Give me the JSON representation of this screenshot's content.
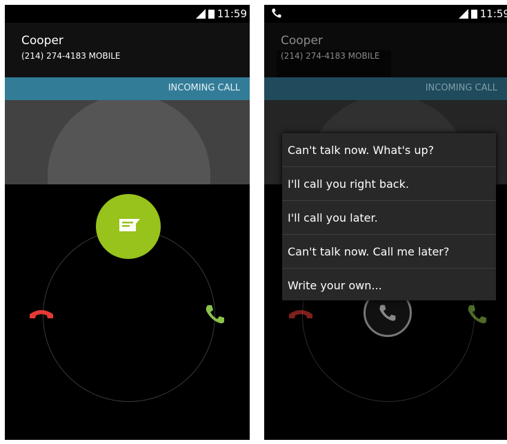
{
  "screen1": {
    "status_time": "11:59",
    "caller_name": "Cooper",
    "caller_number": "(214) 274-4183  MOBILE",
    "incoming_label": "INCOMING CALL"
  },
  "screen2": {
    "status_time": "11:59",
    "caller_name": "Cooper",
    "caller_number": "(214) 274-4183  MOBILE",
    "incoming_label": "INCOMING CALL",
    "quick_responses": [
      "Can't talk now. What's up?",
      "I'll call you right back.",
      "I'll call you later.",
      "Can't talk now. Call me later?",
      "Write your own..."
    ]
  },
  "colors": {
    "accent_blue": "#327c98",
    "message_green": "#98c21c",
    "decline_red": "#e53935",
    "answer_green": "#8bc34a"
  },
  "icons": {
    "message": "message-icon",
    "decline": "decline-call-icon",
    "answer": "answer-call-icon",
    "signal": "signal-icon",
    "battery": "battery-icon",
    "phone": "phone-icon"
  }
}
